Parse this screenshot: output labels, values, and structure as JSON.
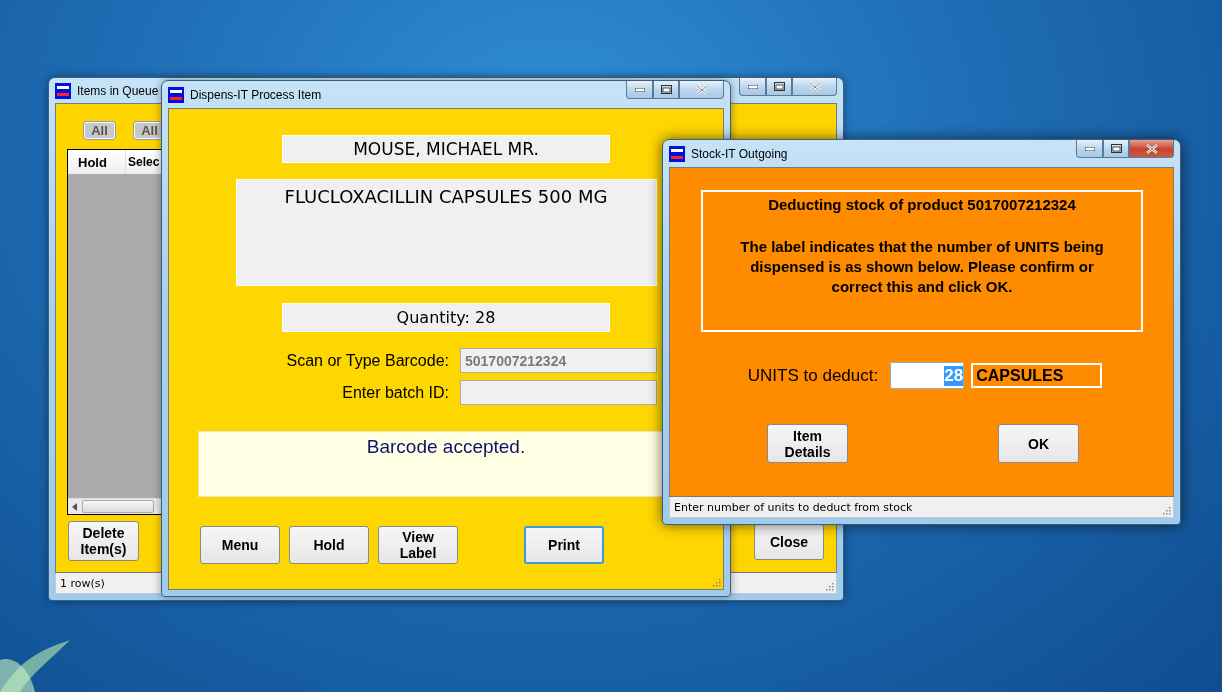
{
  "queue_window": {
    "title": "Items in Queue",
    "active": false,
    "select_buttons": [
      "All",
      "All"
    ],
    "grid_columns": [
      "Hold",
      "Selec"
    ],
    "delete_button": "Delete Item(s)",
    "close_button": "Close",
    "status": "1 row(s)"
  },
  "process_window": {
    "title": "Dispens-IT Process Item",
    "active": false,
    "patient": "MOUSE, MICHAEL MR.",
    "product": "FLUCLOXACILLIN CAPSULES 500 MG",
    "quantity": "Quantity: 28",
    "fields": [
      {
        "label": "Scan or Type Barcode:",
        "value": "5017007212324"
      },
      {
        "label": "Enter batch ID:"
      }
    ],
    "message": "Barcode accepted.",
    "buttons": [
      {
        "label": "Menu",
        "focused": false
      },
      {
        "label": "Hold",
        "focused": false
      },
      {
        "label": "View Label",
        "focused": false
      },
      {
        "label": "Print",
        "focused": true
      }
    ]
  },
  "stock_window": {
    "title": "Stock-IT Outgoing",
    "active": true,
    "heading": "Deducting stock of product 5017007212324",
    "message": "The label indicates that the number of UNITS being dispensed is as shown below.  Please confirm or correct this and click OK.",
    "units_label": "UNITS to deduct:",
    "units_value": "28",
    "unit_name": "CAPSULES",
    "buttons": [
      "Item Details",
      "OK"
    ],
    "status": "Enter number of units to deduct from stock"
  }
}
